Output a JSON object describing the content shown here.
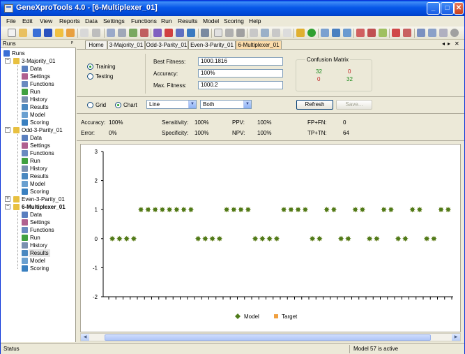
{
  "window": {
    "title": "GeneXproTools 4.0 - [6-Multiplexer_01]"
  },
  "menu": [
    "File",
    "Edit",
    "View",
    "Reports",
    "Data",
    "Settings",
    "Functions",
    "Run",
    "Results",
    "Model",
    "Scoring",
    "Help"
  ],
  "left_pane": {
    "header": "Runs",
    "root": "Runs",
    "runs": [
      {
        "name": "3-Majority_01",
        "expanded": true,
        "children": [
          "Data",
          "Settings",
          "Functions",
          "Run",
          "History",
          "Results",
          "Model",
          "Scoring"
        ]
      },
      {
        "name": "Odd-3-Parity_01",
        "expanded": true,
        "children": [
          "Data",
          "Settings",
          "Functions",
          "Run",
          "History",
          "Results",
          "Model",
          "Scoring"
        ]
      },
      {
        "name": "Even-3-Parity_01",
        "expanded": false,
        "children": []
      },
      {
        "name": "6-Multiplexer_01",
        "expanded": true,
        "children": [
          "Data",
          "Settings",
          "Functions",
          "Run",
          "History",
          "Results",
          "Model",
          "Scoring"
        ],
        "selected_child": "Results"
      }
    ]
  },
  "tabs": [
    "Home",
    "3-Majority_01",
    "Odd-3-Parity_01",
    "Even-3-Parity_01",
    "6-Multiplexer_01"
  ],
  "active_tab": "6-Multiplexer_01",
  "dataset": {
    "training": "Training",
    "testing": "Testing",
    "selected": "Training"
  },
  "fitness": {
    "best_label": "Best Fitness:",
    "best_value": "1000.1816",
    "accuracy_label": "Accuracy:",
    "accuracy_value": "100%",
    "max_label": "Max. Fitness:",
    "max_value": "1000.2"
  },
  "confusion": {
    "title": "Confusion Matrix",
    "tp": "32",
    "fp": "0",
    "fn": "0",
    "tn": "32"
  },
  "view": {
    "grid": "Grid",
    "chart": "Chart",
    "selected": "Chart",
    "chart_type": "Line",
    "series_filter": "Both",
    "refresh": "Refresh",
    "save": "Save..."
  },
  "stats": {
    "accuracy_label": "Accuracy:",
    "accuracy": "100%",
    "error_label": "Error:",
    "error": "0%",
    "sensitivity_label": "Sensitivity:",
    "sensitivity": "100%",
    "specificity_label": "Specificity:",
    "specificity": "100%",
    "ppv_label": "PPV:",
    "ppv": "100%",
    "npv_label": "NPV:",
    "npv": "100%",
    "fpfn_label": "FP+FN:",
    "fpfn": "0",
    "tptn_label": "TP+TN:",
    "tptn": "64"
  },
  "chart_data": {
    "type": "scatter",
    "ylim": [
      -2,
      3
    ],
    "yticks": [
      "3",
      "2",
      "1",
      "0",
      "-1",
      "-2"
    ],
    "series": [
      {
        "name": "Model",
        "color": "#4f7b1a",
        "values": [
          0,
          0,
          0,
          0,
          1,
          1,
          1,
          1,
          1,
          1,
          1,
          1,
          0,
          0,
          0,
          0,
          1,
          1,
          1,
          1,
          0,
          0,
          0,
          0,
          1,
          1,
          1,
          1,
          0,
          0,
          1,
          1,
          0,
          0,
          1,
          1,
          0,
          0,
          1,
          1,
          0,
          0,
          1,
          1,
          0,
          0,
          1,
          1
        ]
      },
      {
        "name": "Target",
        "color": "#f0a040",
        "values": [
          0,
          0,
          0,
          0,
          1,
          1,
          1,
          1,
          1,
          1,
          1,
          1,
          0,
          0,
          0,
          0,
          1,
          1,
          1,
          1,
          0,
          0,
          0,
          0,
          1,
          1,
          1,
          1,
          0,
          0,
          1,
          1,
          0,
          0,
          1,
          1,
          0,
          0,
          1,
          1,
          0,
          0,
          1,
          1,
          0,
          0,
          1,
          1
        ]
      }
    ]
  },
  "status": {
    "left": "Status",
    "right": "Model 57 is active"
  }
}
